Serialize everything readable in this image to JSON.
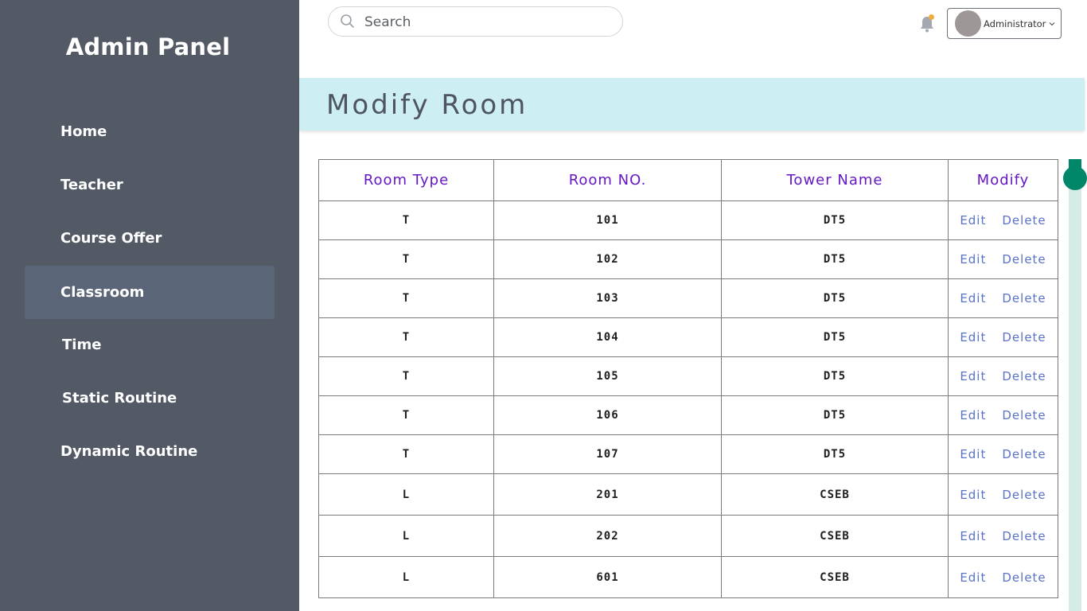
{
  "sidebar": {
    "brand": "Admin Panel",
    "items": [
      {
        "label": "Home"
      },
      {
        "label": "Teacher"
      },
      {
        "label": "Course Offer"
      },
      {
        "label": "Classroom"
      },
      {
        "label": "Time"
      },
      {
        "label": "Static Routine"
      },
      {
        "label": "Dynamic Routine"
      }
    ],
    "active_item": "Classroom"
  },
  "header": {
    "search": {
      "placeholder": "Search",
      "value": ""
    },
    "notification_icon": "bell-icon",
    "notification_dot_color": "#f0ad3c",
    "user_label": "Administrator"
  },
  "main": {
    "title": "Modify Room",
    "table": {
      "headers": [
        "Room Type",
        "Room NO.",
        "Tower Name",
        "Modify"
      ],
      "rows": [
        {
          "type": "T",
          "number": "101",
          "tower": "DT5"
        },
        {
          "type": "T",
          "number": "102",
          "tower": "DT5"
        },
        {
          "type": "T",
          "number": "103",
          "tower": "DT5"
        },
        {
          "type": "T",
          "number": "104",
          "tower": "DT5"
        },
        {
          "type": "T",
          "number": "105",
          "tower": "DT5"
        },
        {
          "type": "T",
          "number": "106",
          "tower": "DT5"
        },
        {
          "type": "T",
          "number": "107",
          "tower": "DT5"
        },
        {
          "type": "L",
          "number": "201",
          "tower": "CSEB"
        },
        {
          "type": "L",
          "number": "202",
          "tower": "CSEB"
        },
        {
          "type": "L",
          "number": "601",
          "tower": "CSEB"
        }
      ],
      "edit_label": "Edit",
      "delete_label": "Delete"
    }
  },
  "colors": {
    "sidebar_bg": "#535a66",
    "active_item_bg": "#5b6578",
    "title_bar_bg": "#cdeef3",
    "header_text": "#6517c4",
    "link": "#5a72c8",
    "scrollbar": "#00876a"
  }
}
